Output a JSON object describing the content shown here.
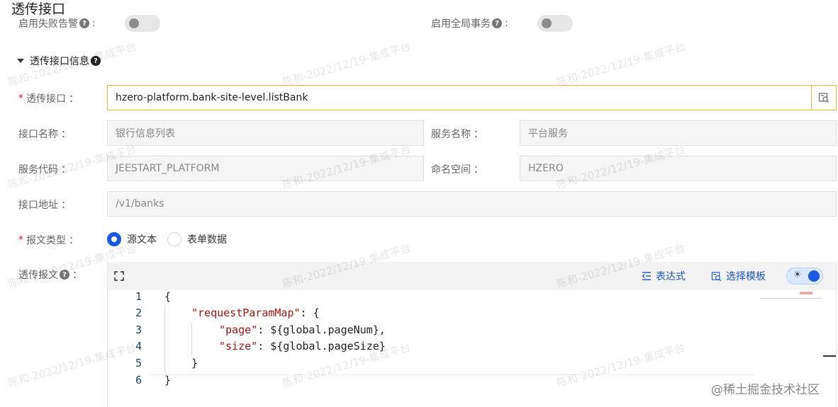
{
  "page_title": "透传接口",
  "top_switches": {
    "fail_alert_label": "启用失败告警",
    "global_tx_label": "启用全局事务",
    "colon": ":"
  },
  "section": {
    "title": "透传接口信息"
  },
  "form": {
    "interface_label": "透传接口",
    "interface_value": "hzero-platform.bank-site-level.listBank",
    "name_label": "接口名称",
    "name_value": "银行信息列表",
    "service_name_label": "服务名称",
    "service_name_value": "平台服务",
    "service_code_label": "服务代码",
    "service_code_value": "JEESTART_PLATFORM",
    "namespace_label": "命名空间",
    "namespace_value": "HZERO",
    "address_label": "接口地址",
    "address_value": "/v1/banks",
    "msg_type_label": "报文类型",
    "msg_type_options": [
      "源文本",
      "表单数据"
    ],
    "msg_type_selected": "源文本",
    "message_label": "透传报文",
    "colon": "："
  },
  "editor": {
    "expression_label": "表达式",
    "template_label": "选择模板",
    "theme_toggle_on": true,
    "lines": [
      {
        "no": "1",
        "code": "{"
      },
      {
        "no": "2",
        "key": "\"requestParamMap\"",
        "rest": ": {"
      },
      {
        "no": "3",
        "key": "\"page\"",
        "rest": ": ${global.pageNum},"
      },
      {
        "no": "4",
        "key": "\"size\"",
        "rest": ": ${global.pageSize}"
      },
      {
        "no": "5",
        "code": "}"
      },
      {
        "no": "6",
        "code": "}"
      }
    ]
  },
  "watermark_text": "陈和-2022/12/19-集成平台",
  "credit_text": "@稀土掘金技术社区",
  "colors": {
    "accent": "#1a5ae0",
    "focus_border": "#e6b840",
    "required": "#e23333"
  }
}
